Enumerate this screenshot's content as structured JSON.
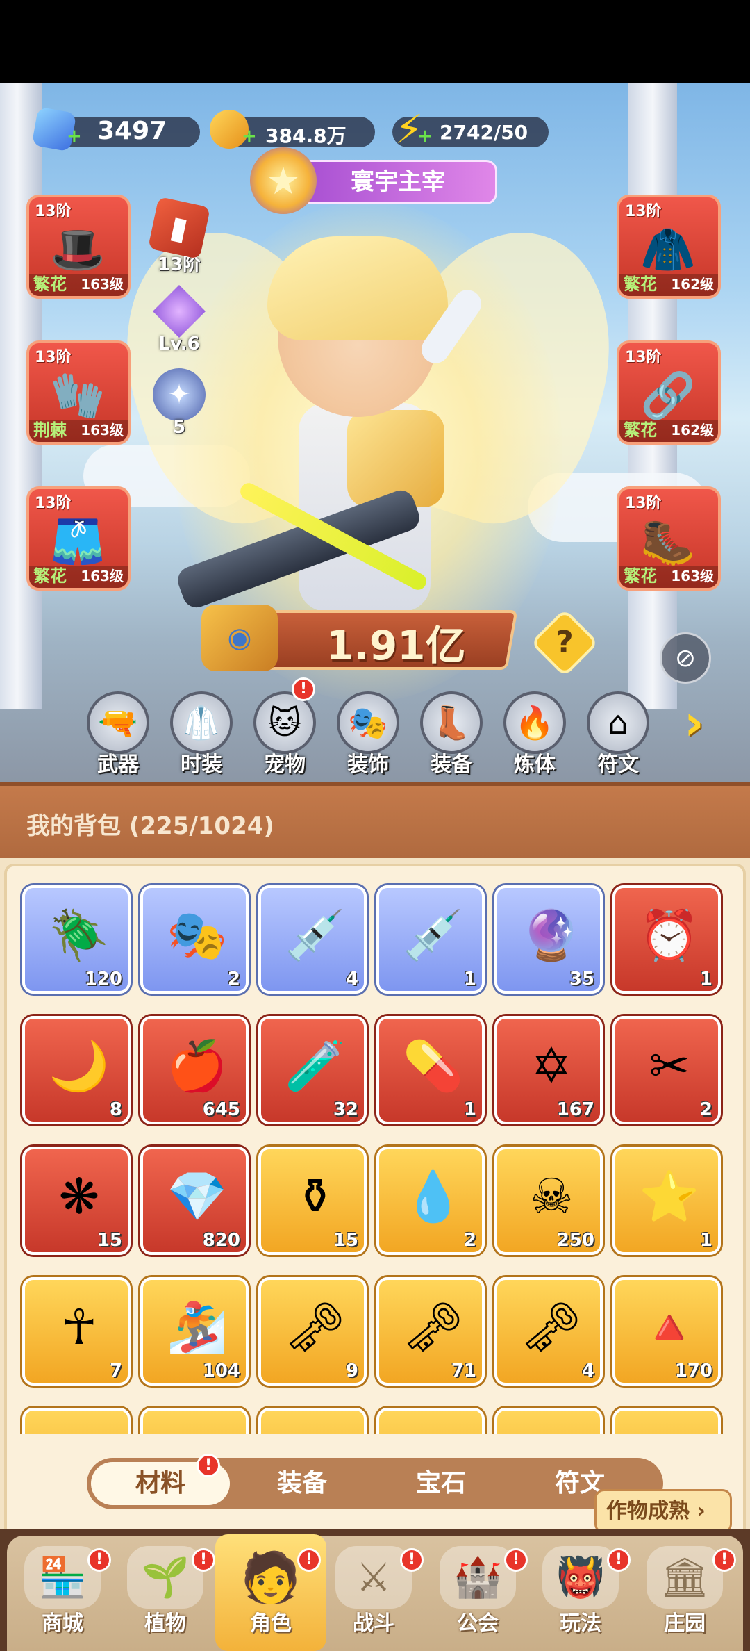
{
  "resources": {
    "diamonds": "3497",
    "coins": "384.8万",
    "energy": "2742/50"
  },
  "title_banner": "寰宇主宰",
  "equipment": {
    "left": [
      {
        "tier": "13阶",
        "name": "繁花",
        "level": "163级",
        "icon": "hat-icon"
      },
      {
        "tier": "13阶",
        "name": "荆棘",
        "level": "163级",
        "icon": "glove-icon"
      },
      {
        "tier": "13阶",
        "name": "繁花",
        "level": "163级",
        "icon": "shorts-icon"
      }
    ],
    "right": [
      {
        "tier": "13阶",
        "name": "繁花",
        "level": "162级",
        "icon": "jacket-icon"
      },
      {
        "tier": "13阶",
        "name": "繁花",
        "level": "162级",
        "icon": "belt-icon"
      },
      {
        "tier": "13阶",
        "name": "繁花",
        "level": "163级",
        "icon": "boots-icon"
      }
    ]
  },
  "mini_stats": {
    "tier": "13阶",
    "level": "Lv.6",
    "star": "5"
  },
  "power": "1.91亿",
  "categories": [
    "武器",
    "时装",
    "宠物",
    "装饰",
    "装备",
    "炼体",
    "符文"
  ],
  "bag": {
    "title": "我的背包 (225/1024)",
    "items": [
      {
        "count": "120",
        "rarity": "blue",
        "icon": "scarab-icon"
      },
      {
        "count": "2",
        "rarity": "blue",
        "icon": "mask-icon"
      },
      {
        "count": "4",
        "rarity": "blue",
        "icon": "syringe-icon"
      },
      {
        "count": "1",
        "rarity": "blue",
        "icon": "syringe-cloud-icon"
      },
      {
        "count": "35",
        "rarity": "blue",
        "icon": "orbit-orb-icon"
      },
      {
        "count": "1",
        "rarity": "red",
        "icon": "clock-card-icon"
      },
      {
        "count": "8",
        "rarity": "red",
        "icon": "moon-star-icon"
      },
      {
        "count": "645",
        "rarity": "red",
        "icon": "red-potion-icon"
      },
      {
        "count": "32",
        "rarity": "red",
        "icon": "green-tube-icon"
      },
      {
        "count": "1",
        "rarity": "red",
        "icon": "green-capsule-icon"
      },
      {
        "count": "167",
        "rarity": "red",
        "icon": "hexagram-icon"
      },
      {
        "count": "2",
        "rarity": "red",
        "icon": "scissors-icon"
      },
      {
        "count": "15",
        "rarity": "red",
        "icon": "knot-icon"
      },
      {
        "count": "820",
        "rarity": "red",
        "icon": "crystal-cluster-icon"
      },
      {
        "count": "15",
        "rarity": "gold",
        "icon": "gold-vial-icon"
      },
      {
        "count": "2",
        "rarity": "gold",
        "icon": "water-drop-icon"
      },
      {
        "count": "250",
        "rarity": "gold",
        "icon": "skull-scroll-icon"
      },
      {
        "count": "1",
        "rarity": "gold",
        "icon": "gold-star-plate-icon"
      },
      {
        "count": "7",
        "rarity": "gold",
        "icon": "ankh-icon"
      },
      {
        "count": "104",
        "rarity": "gold",
        "icon": "snowboard-icon"
      },
      {
        "count": "9",
        "rarity": "gold",
        "icon": "ruby-key-icon"
      },
      {
        "count": "71",
        "rarity": "gold",
        "icon": "gold-key-icon"
      },
      {
        "count": "4",
        "rarity": "gold",
        "icon": "emerald-key-icon"
      },
      {
        "count": "170",
        "rarity": "gold",
        "icon": "fire-prism-icon"
      },
      {
        "count": "",
        "rarity": "gold",
        "icon": "partial-item-icon"
      },
      {
        "count": "",
        "rarity": "gold",
        "icon": "partial-item-icon"
      },
      {
        "count": "",
        "rarity": "gold",
        "icon": "partial-item-icon"
      },
      {
        "count": "",
        "rarity": "gold",
        "icon": "partial-item-icon"
      },
      {
        "count": "",
        "rarity": "gold",
        "icon": "partial-item-icon"
      },
      {
        "count": "",
        "rarity": "gold",
        "icon": "partial-item-icon"
      }
    ]
  },
  "tabs": [
    "材料",
    "装备",
    "宝石",
    "符文"
  ],
  "harvest_button": "作物成熟",
  "nav": [
    "商城",
    "植物",
    "角色",
    "战斗",
    "公会",
    "玩法",
    "庄园"
  ],
  "colors": {
    "rarity_blue": "#7e96f0",
    "rarity_red": "#c7382a",
    "rarity_gold": "#f2a623",
    "slot_name_green": "#b6f07a",
    "badge_red": "#e8342a"
  }
}
